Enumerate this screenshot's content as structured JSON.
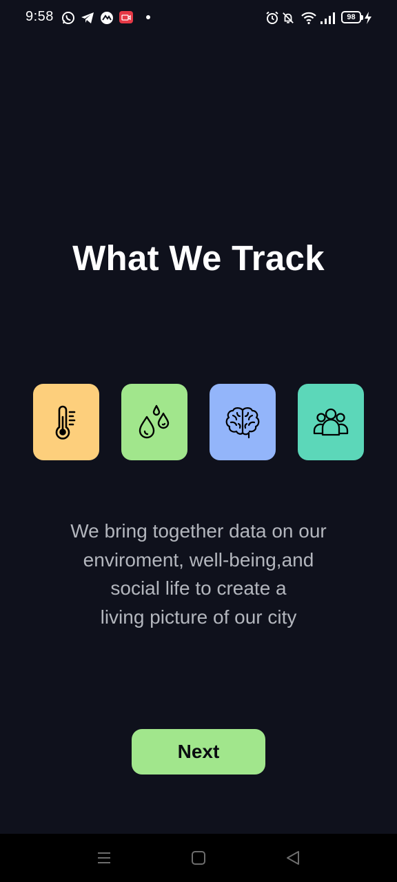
{
  "status_bar": {
    "time": "9:58",
    "battery_level": "98",
    "icons": [
      "whatsapp-icon",
      "telegram-icon",
      "app-icon",
      "screen-record-icon",
      "notification-dot",
      "alarm-icon",
      "mute-icon",
      "wifi-icon",
      "signal-icon",
      "battery-icon",
      "charging-icon"
    ]
  },
  "main": {
    "title": "What We Track",
    "tiles": [
      {
        "icon": "thermometer-icon",
        "color": "#fdcf7c"
      },
      {
        "icon": "water-drops-icon",
        "color": "#a1e68c"
      },
      {
        "icon": "brain-icon",
        "color": "#93b5fa"
      },
      {
        "icon": "people-icon",
        "color": "#5cd7b9"
      }
    ],
    "description": "We bring together data on our\nenviroment, well-being,and\nsocial life to create a\nliving picture of our city",
    "next_label": "Next"
  },
  "nav_bar": {
    "icons": [
      "menu-icon",
      "home-icon",
      "back-icon"
    ]
  },
  "colors": {
    "background": "#0f111c",
    "accent": "#a1e68c",
    "text_primary": "#ffffff",
    "text_secondary": "#b3b6bd"
  }
}
